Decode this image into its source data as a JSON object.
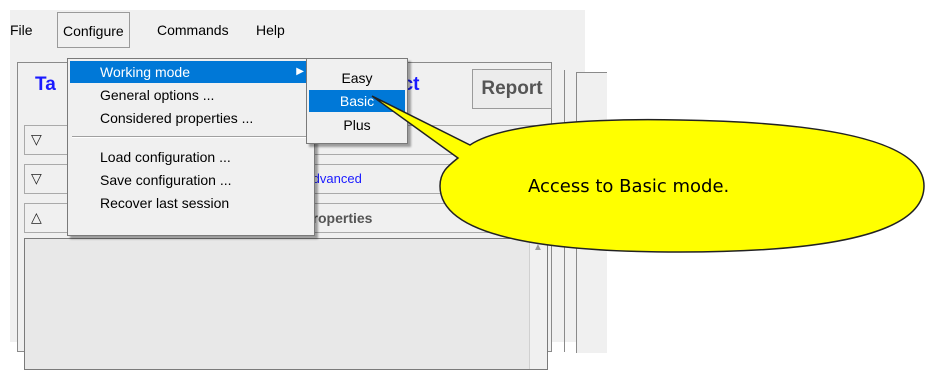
{
  "menubar": {
    "file": "File",
    "configure": "Configure",
    "commands": "Commands",
    "help": "Help"
  },
  "tabs": {
    "left_fragment": "Ta",
    "ect_fragment": "ect",
    "report": "Report"
  },
  "rows": {
    "row2_text": "Advanced",
    "row3_text": "properties"
  },
  "configure_menu": {
    "working_mode": "Working mode",
    "general_options": "General options ...",
    "considered_properties": "Considered properties ...",
    "load_configuration": "Load configuration ...",
    "save_configuration": "Save configuration ...",
    "recover_last_session": "Recover last session"
  },
  "working_mode_submenu": {
    "easy": "Easy",
    "basic": "Basic",
    "plus": "Plus",
    "selected": "Basic"
  },
  "callout": {
    "text": "Access to Basic mode.",
    "fill_color": "#ffff00"
  },
  "colors": {
    "highlight": "#0078d7",
    "tab_blue": "#1a1aff"
  },
  "icons": {
    "submenu_arrow": "triangle-right-icon",
    "collapse": "triangle-down-icon",
    "expand": "triangle-up-icon",
    "scroll_up": "chevron-up-icon"
  }
}
